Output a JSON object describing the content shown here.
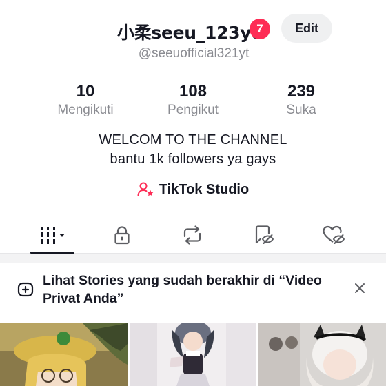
{
  "profile": {
    "username": "小柔seeu_123yt",
    "notification_count": "7",
    "edit_label": "Edit",
    "handle": "@seeuofficial321yt"
  },
  "stats": [
    {
      "value": "10",
      "label": "Mengikuti"
    },
    {
      "value": "108",
      "label": "Pengikut"
    },
    {
      "value": "239",
      "label": "Suka"
    }
  ],
  "bio": {
    "line1": "WELCOM TO THE CHANNEL",
    "line2": "bantu 1k followers ya gays"
  },
  "studio": {
    "label": "TikTok Studio",
    "icon": "person-star-icon",
    "icon_color": "#fe2c55"
  },
  "tabs": [
    {
      "name": "videos",
      "icon": "grid-dropdown-icon",
      "active": true
    },
    {
      "name": "private",
      "icon": "lock-icon",
      "active": false
    },
    {
      "name": "reposts",
      "icon": "repost-icon",
      "active": false
    },
    {
      "name": "favorites",
      "icon": "bookmark-hidden-icon",
      "active": false
    },
    {
      "name": "liked",
      "icon": "heart-hidden-icon",
      "active": false
    }
  ],
  "banner": {
    "text": "Lihat Stories yang sudah berakhir di “Video Privat Anda”",
    "icon": "stories-plus-icon",
    "close_icon": "close-icon"
  },
  "videos": [
    {
      "thumbnail": "video-thumbnail-1"
    },
    {
      "thumbnail": "video-thumbnail-2"
    },
    {
      "thumbnail": "video-thumbnail-3"
    }
  ],
  "colors": {
    "accent": "#fe2c55",
    "text": "#161823",
    "muted": "#8a8b91"
  }
}
